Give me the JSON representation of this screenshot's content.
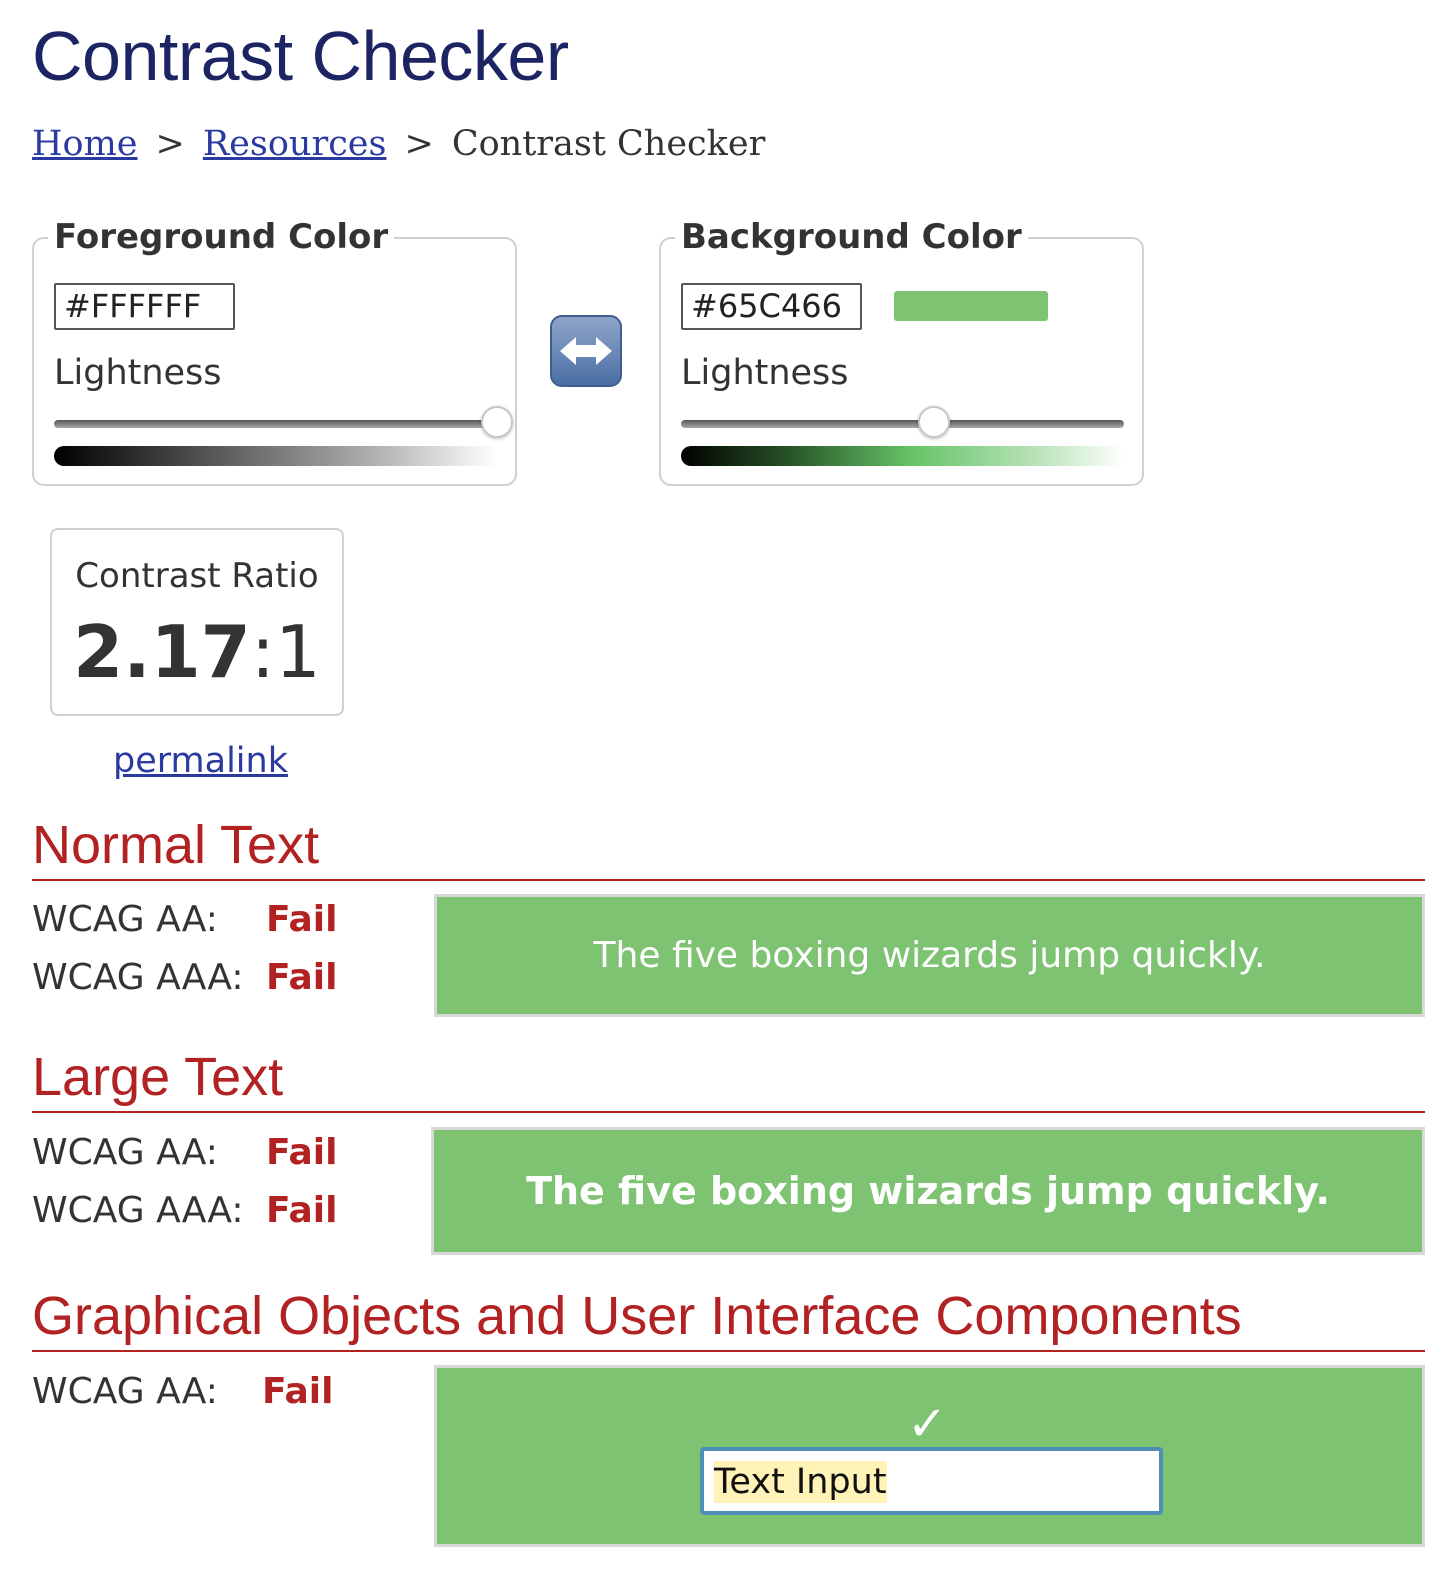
{
  "header": {
    "title": "Contrast Checker"
  },
  "breadcrumb": {
    "home": "Home",
    "resources": "Resources",
    "current": "Contrast Checker",
    "separator": ">"
  },
  "foreground": {
    "legend": "Foreground Color",
    "hex_value": "#FFFFFF",
    "lightness_label": "Lightness",
    "lightness_level": 1.0
  },
  "background": {
    "legend": "Background Color",
    "hex_value": "#65C466",
    "swatch_color": "#7EC372",
    "lightness_label": "Lightness",
    "lightness_level": 0.57
  },
  "swap": {
    "icon": "left-right-arrow-icon"
  },
  "contrast": {
    "label": "Contrast Ratio",
    "ratio_strong": "2.17",
    "ratio_rest": ":1",
    "permalink": "permalink"
  },
  "sections": {
    "normal": {
      "heading": "Normal Text",
      "aa_label": "WCAG AA:",
      "aa_result": "Fail",
      "aaa_label": "WCAG AAA:",
      "aaa_result": "Fail",
      "sample": "The five boxing wizards jump quickly."
    },
    "large": {
      "heading": "Large Text",
      "aa_label": "WCAG AA:",
      "aa_result": "Fail",
      "aaa_label": "WCAG AAA:",
      "aaa_result": "Fail",
      "sample": "The five boxing wizards jump quickly."
    },
    "graphical": {
      "heading": "Graphical Objects and User Interface Components",
      "aa_label": "WCAG AA:",
      "aa_result": "Fail",
      "checkmark": "✓",
      "input_text": "Text Input"
    }
  },
  "colors": {
    "title": "#1C2463",
    "link": "#2A3AA0",
    "fail": "#B22222",
    "preview_bg": "#7EC372",
    "preview_fg": "#FFFFFF"
  }
}
